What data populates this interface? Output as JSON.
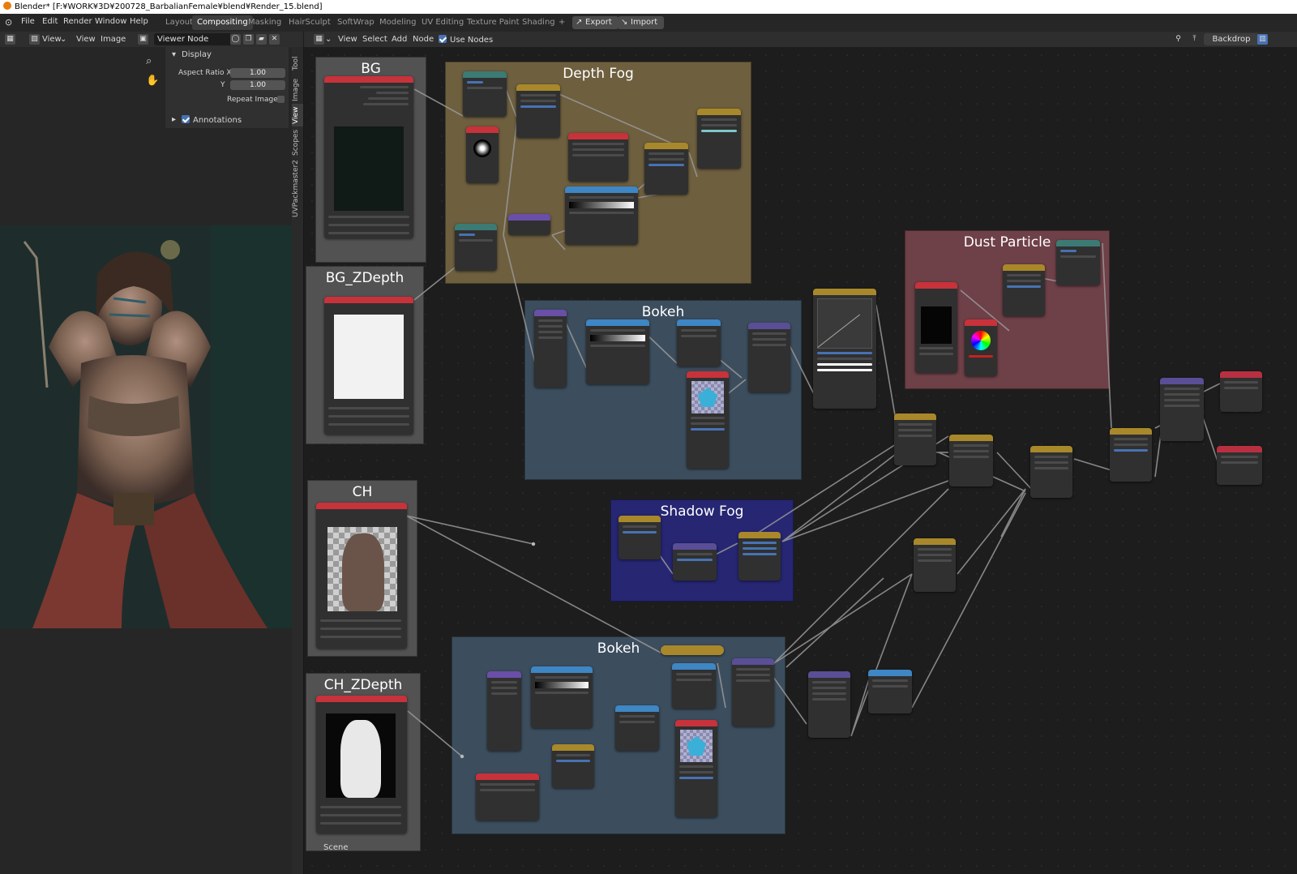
{
  "window": {
    "title": "Blender* [F:¥WORK¥3D¥200728_BarbalianFemale¥blend¥Render_15.blend]"
  },
  "menu": {
    "items": [
      "File",
      "Edit",
      "Render",
      "Window",
      "Help"
    ]
  },
  "workspaces": {
    "tabs": [
      "Layout",
      "Compositing",
      "Masking",
      "HairSculpt",
      "SoftWrap",
      "Modeling",
      "UV Editing",
      "Texture Paint",
      "Shading"
    ],
    "active": "Compositing",
    "add": "+"
  },
  "toolbar": {
    "export_label": "Export",
    "import_label": "Import"
  },
  "image_editor": {
    "header": {
      "view_mode": "View",
      "menu_view": "View",
      "menu_image": "Image",
      "image_name": "Viewer Node"
    },
    "display_panel": {
      "title": "Display",
      "aspect_ratio_x_label": "Aspect Ratio X",
      "aspect_ratio_x_value": "1.00",
      "y_label": "Y",
      "y_value": "1.00",
      "repeat_image_label": "Repeat Image"
    },
    "annotations_panel": {
      "title": "Annotations"
    },
    "vertical_tabs": [
      "Tool",
      "Image",
      "View",
      "Scopes",
      "UVPackmaster2"
    ]
  },
  "node_editor": {
    "header": {
      "menu_view": "View",
      "menu_select": "Select",
      "menu_add": "Add",
      "menu_node": "Node",
      "use_nodes_label": "Use Nodes",
      "backdrop_label": "Backdrop"
    },
    "frames": {
      "bg": "BG",
      "bg_zdepth": "BG_ZDepth",
      "ch": "CH",
      "ch_zdepth": "CH_ZDepth",
      "depth_fog": "Depth Fog",
      "bokeh_top": "Bokeh",
      "shadow_fog": "Shadow Fog",
      "bokeh_bottom": "Bokeh",
      "dust_particle": "Dust Particle"
    },
    "scene_label": "Scene"
  },
  "colors": {
    "render_layer_header": "#c8323a",
    "converter_header": "#3c7a74",
    "vector_header": "#6a4fa8",
    "color_header": "#a8882a",
    "filter_header": "#5a4e96",
    "output_header": "#b83040",
    "blue_node_header": "#3e86c4"
  }
}
